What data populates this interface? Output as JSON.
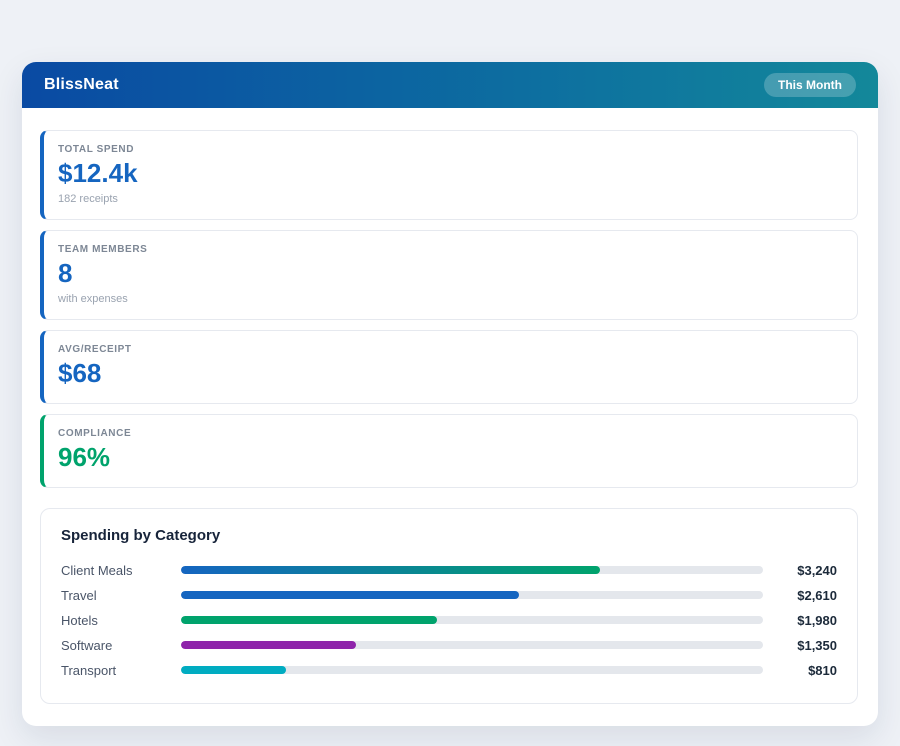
{
  "app": {
    "title": "BlissNeat",
    "period_badge": "This Month"
  },
  "stats": [
    {
      "label": "TOTAL SPEND",
      "value": "$12.4k",
      "sub": "182 receipts",
      "accent": "#1565c0",
      "value_color": "#1565c0"
    },
    {
      "label": "TEAM MEMBERS",
      "value": "8",
      "sub": "with expenses",
      "accent": "#1565c0",
      "value_color": "#1565c0"
    },
    {
      "label": "AVG/RECEIPT",
      "value": "$68",
      "sub": "",
      "accent": "#1565c0",
      "value_color": "#1565c0"
    },
    {
      "label": "COMPLIANCE",
      "value": "96%",
      "sub": "",
      "accent": "#00a36c",
      "value_color": "#00a36c"
    }
  ],
  "chart_data": {
    "type": "bar",
    "title": "Spending by Category",
    "categories": [
      "Client Meals",
      "Travel",
      "Hotels",
      "Software",
      "Transport"
    ],
    "values": [
      3240,
      2610,
      1980,
      1350,
      810
    ],
    "value_labels": [
      "$3,240",
      "$2,610",
      "$1,980",
      "$1,350",
      "$810"
    ],
    "scale_max": 4500,
    "bar_colors": [
      "linear-gradient(90deg, #1565c0, #00a36c)",
      "#1565c0",
      "#00a36c",
      "#8e24aa",
      "#00acc1"
    ],
    "track_color": "#e4e7ec",
    "legend_position": "none",
    "grid": false
  }
}
